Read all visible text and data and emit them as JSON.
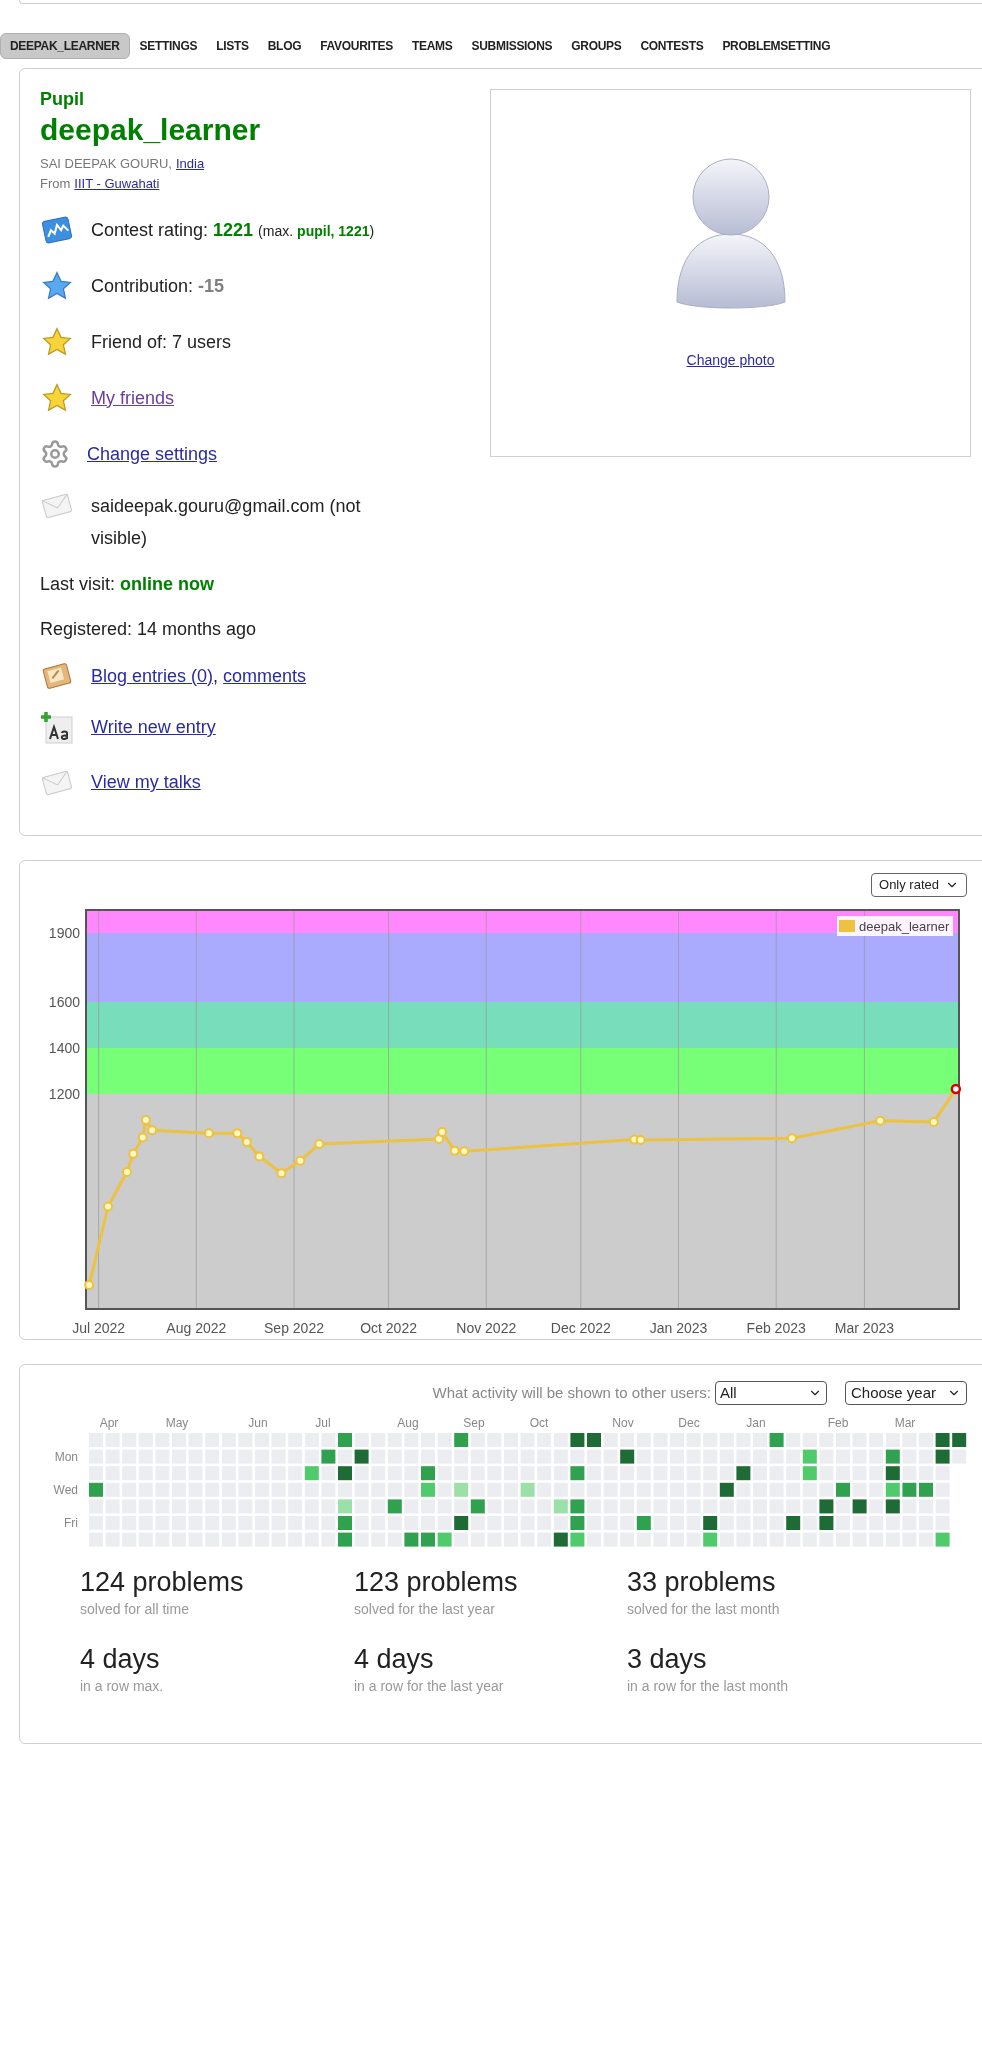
{
  "top_tabs": [
    {
      "label": "DEEPAK_LEARNER",
      "selected": true
    },
    {
      "label": "SETTINGS",
      "selected": false
    },
    {
      "label": "LISTS",
      "selected": false
    },
    {
      "label": "BLOG",
      "selected": false
    },
    {
      "label": "FAVOURITES",
      "selected": false
    },
    {
      "label": "TEAMS",
      "selected": false
    },
    {
      "label": "SUBMISSIONS",
      "selected": false
    },
    {
      "label": "GROUPS",
      "selected": false
    },
    {
      "label": "CONTESTS",
      "selected": false
    },
    {
      "label": "PROBLEMSETTING",
      "selected": false
    }
  ],
  "profile": {
    "rank": "Pupil",
    "handle": "deepak_learner",
    "full_name": "SAI DEEPAK GOURU,",
    "country": {
      "label": "India",
      "visited": false
    },
    "from_label": "From",
    "organization": {
      "label": "IIIT - Guwahati",
      "visited": false
    },
    "contest_rating": {
      "label": "Contest rating:",
      "value": "1221",
      "max_open": "(max.",
      "max_value": "pupil, 1221",
      "max_close": ")"
    },
    "contribution": {
      "label": "Contribution:",
      "value": "-15"
    },
    "friend_of": "Friend of: 7 users",
    "my_friends": {
      "label": "My friends",
      "visited": true
    },
    "change_settings": {
      "label": "Change settings",
      "visited": false
    },
    "email": "saideepak.gouru@gmail.com (not visible)",
    "last_visit": {
      "label": "Last visit:",
      "value": "online now"
    },
    "registered": "Registered: 14 months ago",
    "blog_entries": {
      "label": "Blog entries (0)",
      "visited": false
    },
    "blog_separator": ",",
    "comments": {
      "label": "comments",
      "visited": false
    },
    "write_new_entry": {
      "label": "Write new entry",
      "visited": false
    },
    "view_my_talks": {
      "label": "View my talks",
      "visited": false
    },
    "change_photo": {
      "label": "Change photo",
      "visited": false
    }
  },
  "rating_chart": {
    "filter": {
      "value": "Only rated"
    },
    "chart_data": {
      "type": "line",
      "x": [
        "2022-06-28",
        "2022-07-04",
        "2022-07-10",
        "2022-07-12",
        "2022-07-15",
        "2022-07-16",
        "2022-07-18",
        "2022-08-05",
        "2022-08-14",
        "2022-08-17",
        "2022-08-21",
        "2022-08-28",
        "2022-09-03",
        "2022-09-09",
        "2022-10-17",
        "2022-10-18",
        "2022-10-22",
        "2022-10-25",
        "2022-12-18",
        "2022-12-20",
        "2023-02-06",
        "2023-03-06",
        "2023-03-23",
        "2023-03-30"
      ],
      "grid": true,
      "bands": [
        {
          "axis": "y",
          "from": 1200,
          "to": 1400,
          "color": "#77ff77"
        },
        {
          "axis": "y",
          "from": 1400,
          "to": 1600,
          "color": "#77ddbb"
        },
        {
          "axis": "y",
          "from": 1600,
          "to": 1900,
          "color": "#aaaaff"
        },
        {
          "axis": "y",
          "from": 1900,
          "to": 2000,
          "color": "#ff88ff"
        }
      ],
      "series": [
        {
          "name": "deepak_learner",
          "color": "#edc240",
          "marker": true,
          "values": [
            368,
            710,
            860,
            939,
            1010,
            1086,
            1042,
            1029,
            1029,
            991,
            928,
            855,
            909,
            982,
            1004,
            1034,
            952,
            950,
            1001,
            999,
            1007,
            1083,
            1078,
            1221
          ]
        }
      ],
      "xlim": [
        "2022-06-27",
        "2023-03-31"
      ],
      "ylim": [
        264,
        2000
      ],
      "xticks": [
        {
          "value": "2022-07-01",
          "label": "Jul 2022"
        },
        {
          "value": "2022-08-01",
          "label": "Aug 2022"
        },
        {
          "value": "2022-09-01",
          "label": "Sep 2022"
        },
        {
          "value": "2022-10-01",
          "label": "Oct 2022"
        },
        {
          "value": "2022-11-01",
          "label": "Nov 2022"
        },
        {
          "value": "2022-12-01",
          "label": "Dec 2022"
        },
        {
          "value": "2023-01-01",
          "label": "Jan 2023"
        },
        {
          "value": "2023-02-01",
          "label": "Feb 2023"
        },
        {
          "value": "2023-03-01",
          "label": "Mar 2023"
        }
      ],
      "yticks": [
        1200,
        1400,
        1600,
        1900
      ]
    }
  },
  "activity": {
    "visibility_label": "What activity will be shown to other users:",
    "visibility_value": "All",
    "year_select": "Choose year",
    "months": [
      "Apr",
      "May",
      "Jun",
      "Jul",
      "Aug",
      "Sep",
      "Oct",
      "Nov",
      "Dec",
      "Jan",
      "Feb",
      "Mar"
    ],
    "weekdays": [
      "Mon",
      "Wed",
      "Fri"
    ],
    "stats": [
      {
        "value": "124 problems",
        "caption": "solved for all time"
      },
      {
        "value": "123 problems",
        "caption": "solved for the last year"
      },
      {
        "value": "33 problems",
        "caption": "solved for the last month"
      },
      {
        "value": "4 days",
        "caption": "in a row max."
      },
      {
        "value": "4 days",
        "caption": "in a row for the last year"
      },
      {
        "value": "3 days",
        "caption": "in a row for the last month"
      }
    ]
  }
}
